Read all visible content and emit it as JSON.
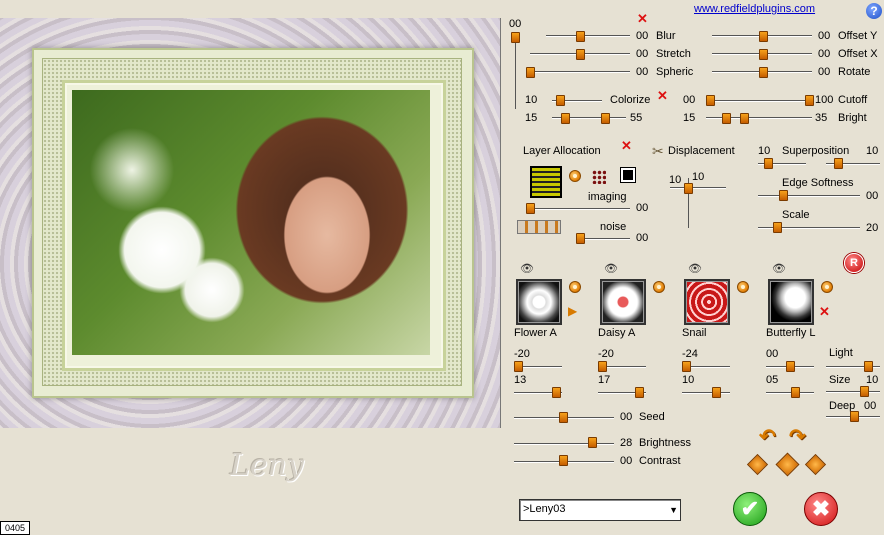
{
  "website": "www.redfieldplugins.com",
  "help": "?",
  "status": "0405",
  "signature": "Leny",
  "top_scale": {
    "value": "00"
  },
  "blur": {
    "label": "Blur",
    "value": "00"
  },
  "stretch": {
    "label": "Stretch",
    "value": "00"
  },
  "spheric": {
    "label": "Spheric",
    "value": "00"
  },
  "offset_y": {
    "label": "Offset Y",
    "value": "00"
  },
  "offset_x": {
    "label": "Offset X",
    "value": "00"
  },
  "rotate": {
    "label": "Rotate",
    "value": "00"
  },
  "colorize": {
    "label": "Colorize",
    "min": "10",
    "max": "15",
    "max2": "55"
  },
  "cutoff": {
    "label": "Cutoff",
    "v1": "00",
    "v2": "100"
  },
  "bright": {
    "label": "Bright",
    "v1": "15",
    "v2": "35"
  },
  "layer_allocation": {
    "label": "Layer Allocation"
  },
  "displacement": {
    "label": "Displacement",
    "v1": "10",
    "v2": "10"
  },
  "superposition": {
    "label": "Superposition",
    "v1": "10",
    "v2": "10"
  },
  "imaging": {
    "label": "imaging",
    "value": "00"
  },
  "noise": {
    "label": "noise",
    "value": "00"
  },
  "edge_softness": {
    "label": "Edge Softness",
    "value": "00"
  },
  "scale": {
    "label": "Scale",
    "value": "20"
  },
  "reset": "R",
  "shapes": [
    {
      "name": "Flower A",
      "top": "-20",
      "bottom": "13"
    },
    {
      "name": "Daisy A",
      "top": "-20",
      "bottom": "17"
    },
    {
      "name": "Snail",
      "top": "-24",
      "bottom": "10"
    },
    {
      "name": "Butterfly L",
      "top": "00",
      "bottom": "05"
    }
  ],
  "light": {
    "label": "Light"
  },
  "size": {
    "label": "Size",
    "value": "10"
  },
  "deep": {
    "label": "Deep",
    "value": "00"
  },
  "seed": {
    "label": "Seed",
    "value": "00"
  },
  "brightness": {
    "label": "Brightness",
    "value": "28"
  },
  "contrast": {
    "label": "Contrast",
    "value": "00"
  },
  "preset": {
    "value": ">Leny03"
  },
  "ok": "✔",
  "cancel": "✖",
  "accent": "#e07a00"
}
